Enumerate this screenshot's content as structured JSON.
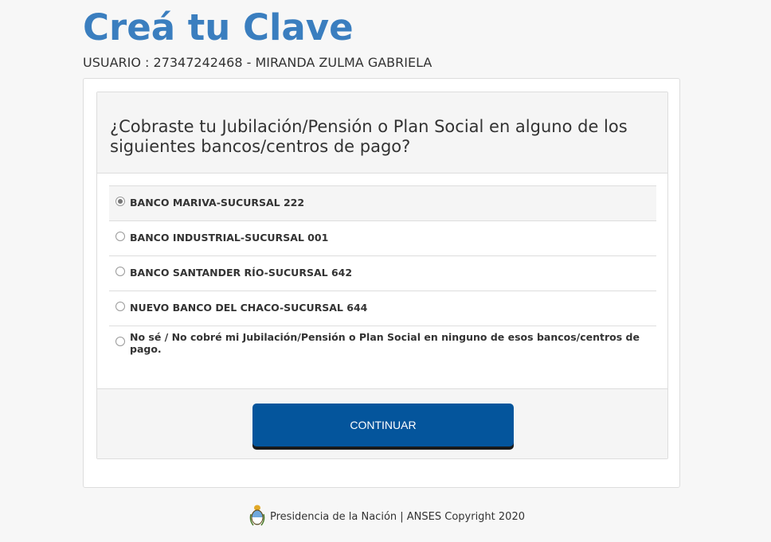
{
  "header": {
    "title": "Creá tu Clave",
    "user_line": "USUARIO : 27347242468 - MIRANDA ZULMA GABRIELA"
  },
  "form": {
    "question": "¿Cobraste tu Jubilación/Pensión o Plan Social en alguno de los siguientes bancos/centros de pago?",
    "options": [
      {
        "label": "BANCO MARIVA-SUCURSAL 222",
        "selected": true
      },
      {
        "label": "BANCO INDUSTRIAL-SUCURSAL 001",
        "selected": false
      },
      {
        "label": "BANCO SANTANDER RÍO-SUCURSAL 642",
        "selected": false
      },
      {
        "label": "NUEVO BANCO DEL CHACO-SUCURSAL 644",
        "selected": false
      },
      {
        "label": "No sé / No cobré mi Jubilación/Pensión o Plan Social en ninguno de esos bancos/centros de pago.",
        "selected": false
      }
    ],
    "continue_label": "CONTINUAR"
  },
  "footer": {
    "text": "Presidencia de la Nación | ANSES Copyright 2020",
    "crest_icon": "argentina-coat-of-arms-icon"
  },
  "colors": {
    "title": "#3a7ebf",
    "button": "#04559c"
  }
}
